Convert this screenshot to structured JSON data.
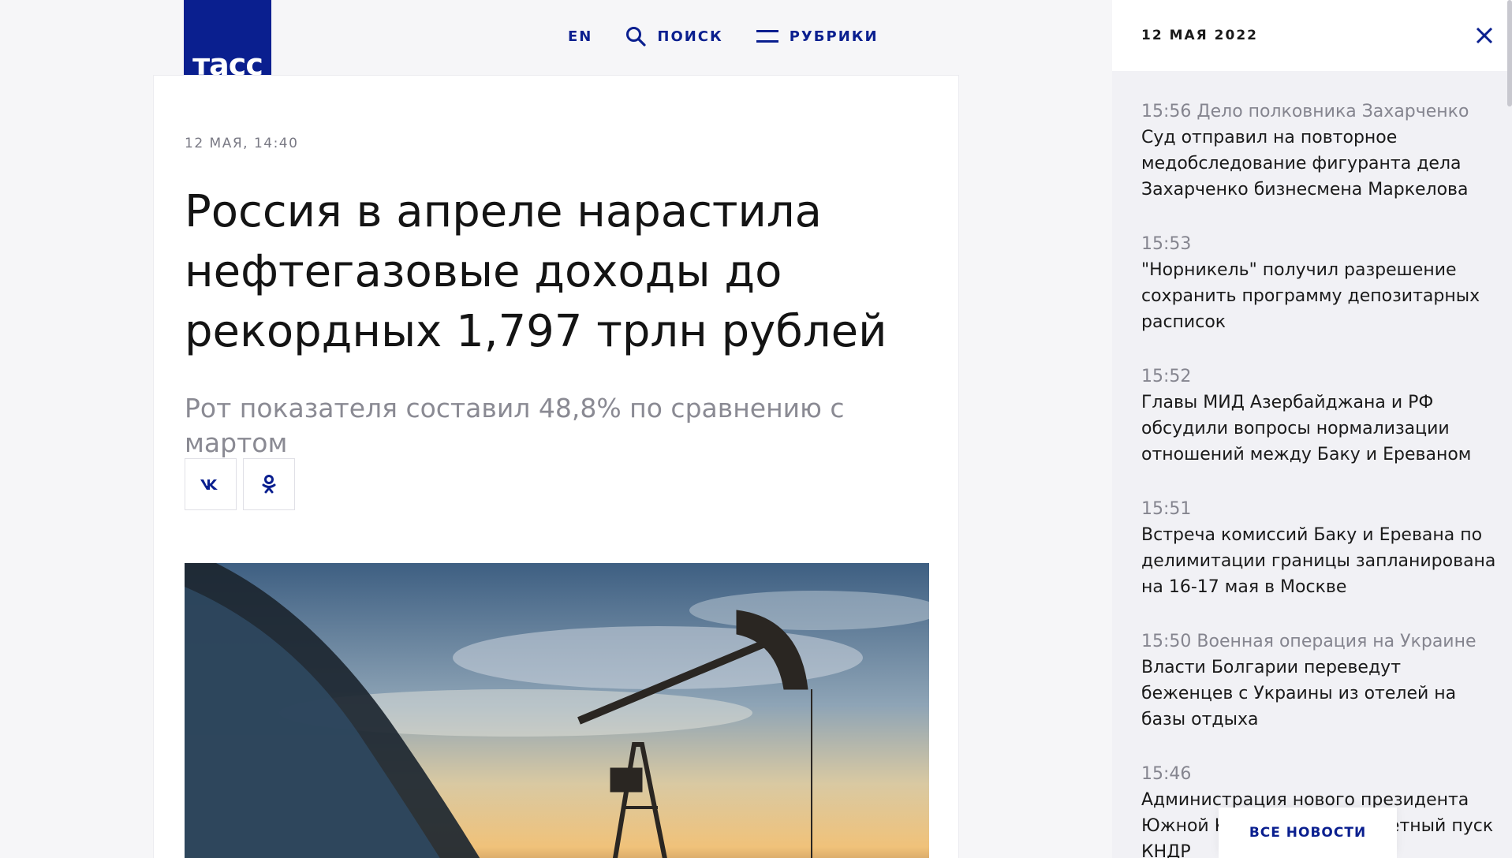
{
  "header": {
    "logo_text": "тасс",
    "lang_label": "EN",
    "search_label": "ПОИСК",
    "rubrics_label": "РУБРИКИ"
  },
  "article": {
    "dateline": "12 МАЯ, 14:40",
    "headline": "Россия в апреле нарастила нефтегазовые доходы до рекордных 1,797 трлн рублей",
    "lead": "Рот показателя составил 48,8% по сравнению с мартом",
    "share": [
      {
        "label": "vk",
        "icon": "vk-icon"
      },
      {
        "label": "ok",
        "icon": "ok-icon"
      }
    ]
  },
  "panel": {
    "date": "12 МАЯ 2022",
    "items": [
      {
        "time": "15:56",
        "rubric": "Дело полковника Захарченко",
        "title": "Суд отправил на повторное медобследование фигуранта дела Захарченко бизнесмена Маркелова"
      },
      {
        "time": "15:53",
        "rubric": "",
        "title": "\"Норникель\" получил разрешение сохранить программу депозитарных расписок"
      },
      {
        "time": "15:52",
        "rubric": "",
        "title": "Главы МИД Азербайджана и РФ обсудили вопросы нормализации отношений между Баку и Ереваном"
      },
      {
        "time": "15:51",
        "rubric": "",
        "title": "Встреча комиссий Баку и Еревана по делимитации границы запланирована на 16-17 мая в Москве"
      },
      {
        "time": "15:50",
        "rubric": "Военная операция на Украине",
        "title": "Власти Болгарии переведут беженцев с Украины из отелей на базы отдыха"
      },
      {
        "time": "15:46",
        "rubric": "",
        "title": "Администрация нового президента Южной Кореи осудила ракетный пуск КНДР"
      }
    ],
    "all_news_label": "ВСЕ НОВОСТИ"
  },
  "colors": {
    "brand": "#0a1f8f",
    "muted": "#85858f"
  }
}
